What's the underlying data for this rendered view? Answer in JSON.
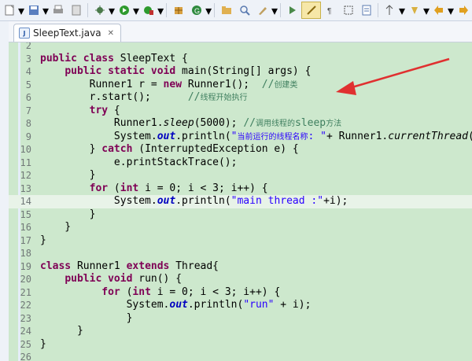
{
  "toolbar": {
    "icons": [
      "new-icon",
      "save-icon",
      "print-icon",
      "debug-icon",
      "run-icon",
      "external-tools-icon",
      "new-package-icon",
      "new-class-icon",
      "open-type-icon",
      "search-icon",
      "next-annotation-icon",
      "previous-annotation-icon",
      "toggle-mark-occurrences-icon",
      "show-whitespace-icon",
      "pin-icon",
      "back-icon",
      "forward-icon"
    ]
  },
  "editor": {
    "tab_label": "SleepText.java",
    "lines": [
      {
        "n": "2",
        "code": ""
      },
      {
        "n": "3",
        "code": "public class SleepText {"
      },
      {
        "n": "4",
        "code": "    public static void main(String[] args) {"
      },
      {
        "n": "5",
        "code": "        Runner1 r = new Runner1();  //创建类"
      },
      {
        "n": "6",
        "code": "        r.start();      //线程开始执行"
      },
      {
        "n": "7",
        "code": "        try {"
      },
      {
        "n": "8",
        "code": "            Runner1.sleep(5000); //调用线程的sleep方法"
      },
      {
        "n": "9",
        "code": "            System.out.println(\"当前运行的线程名称: \"+ Runner1.currentThread("
      },
      {
        "n": "10",
        "code": "        } catch (InterruptedException e) {"
      },
      {
        "n": "11",
        "code": "            e.printStackTrace();"
      },
      {
        "n": "12",
        "code": "        }"
      },
      {
        "n": "13",
        "code": "        for (int i = 0; i < 3; i++) {"
      },
      {
        "n": "14",
        "code": "            System.out.println(\"main thread :\"+i);"
      },
      {
        "n": "15",
        "code": "        }"
      },
      {
        "n": "16",
        "code": "    }"
      },
      {
        "n": "17",
        "code": "}"
      },
      {
        "n": "18",
        "code": ""
      },
      {
        "n": "19",
        "code": "class Runner1 extends Thread{"
      },
      {
        "n": "20",
        "code": "    public void run() {"
      },
      {
        "n": "21",
        "code": "          for (int i = 0; i < 3; i++) {"
      },
      {
        "n": "22",
        "code": "              System.out.println(\"run\" + i);"
      },
      {
        "n": "23",
        "code": "              }"
      },
      {
        "n": "24",
        "code": "      }"
      },
      {
        "n": "25",
        "code": "}"
      },
      {
        "n": "26",
        "code": ""
      }
    ]
  },
  "colors": {
    "editor_bg": "#cde8cd",
    "keyword": "#7f0055",
    "string": "#2a00ff",
    "comment": "#3f7f5f",
    "field": "#0000c0",
    "arrow": "#e03030"
  }
}
